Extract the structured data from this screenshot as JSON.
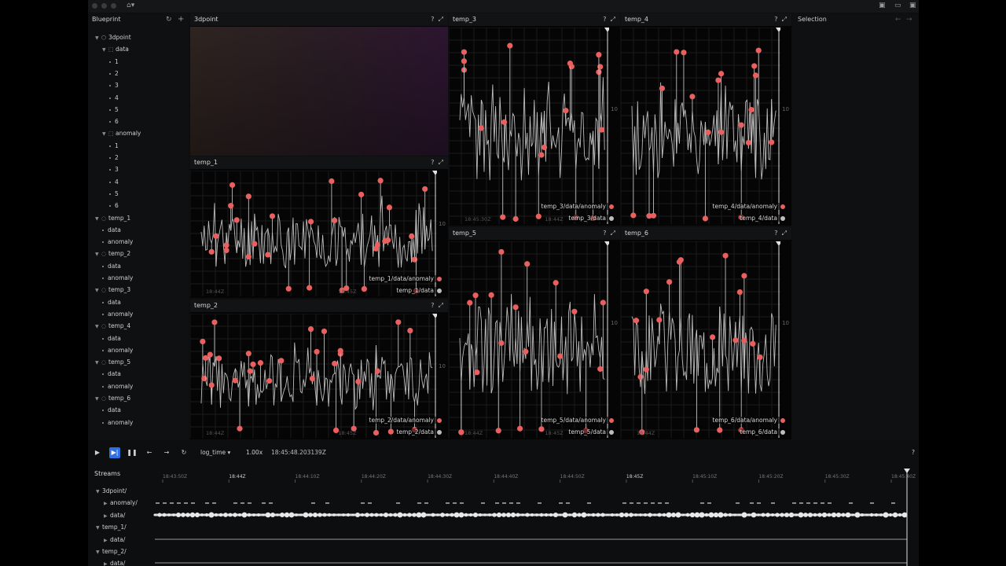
{
  "window": {
    "title_icon": "app-icon"
  },
  "blueprint": {
    "title": "Blueprint",
    "tree": [
      {
        "label": "3dpoint",
        "level": 0,
        "kind": "space"
      },
      {
        "label": "data",
        "level": 1,
        "kind": "group"
      },
      {
        "label": "1",
        "level": 2,
        "kind": "leaf"
      },
      {
        "label": "2",
        "level": 2,
        "kind": "leaf"
      },
      {
        "label": "3",
        "level": 2,
        "kind": "leaf"
      },
      {
        "label": "4",
        "level": 2,
        "kind": "leaf"
      },
      {
        "label": "5",
        "level": 2,
        "kind": "leaf"
      },
      {
        "label": "6",
        "level": 2,
        "kind": "leaf"
      },
      {
        "label": "anomaly",
        "level": 1,
        "kind": "group"
      },
      {
        "label": "1",
        "level": 2,
        "kind": "leaf"
      },
      {
        "label": "2",
        "level": 2,
        "kind": "leaf"
      },
      {
        "label": "3",
        "level": 2,
        "kind": "leaf"
      },
      {
        "label": "4",
        "level": 2,
        "kind": "leaf"
      },
      {
        "label": "5",
        "level": 2,
        "kind": "leaf"
      },
      {
        "label": "6",
        "level": 2,
        "kind": "leaf"
      },
      {
        "label": "temp_1",
        "level": 0,
        "kind": "series"
      },
      {
        "label": "data",
        "level": 1,
        "kind": "leaf"
      },
      {
        "label": "anomaly",
        "level": 1,
        "kind": "leaf"
      },
      {
        "label": "temp_2",
        "level": 0,
        "kind": "series"
      },
      {
        "label": "data",
        "level": 1,
        "kind": "leaf"
      },
      {
        "label": "anomaly",
        "level": 1,
        "kind": "leaf"
      },
      {
        "label": "temp_3",
        "level": 0,
        "kind": "series"
      },
      {
        "label": "data",
        "level": 1,
        "kind": "leaf"
      },
      {
        "label": "anomaly",
        "level": 1,
        "kind": "leaf"
      },
      {
        "label": "temp_4",
        "level": 0,
        "kind": "series"
      },
      {
        "label": "data",
        "level": 1,
        "kind": "leaf"
      },
      {
        "label": "anomaly",
        "level": 1,
        "kind": "leaf"
      },
      {
        "label": "temp_5",
        "level": 0,
        "kind": "series"
      },
      {
        "label": "data",
        "level": 1,
        "kind": "leaf"
      },
      {
        "label": "anomaly",
        "level": 1,
        "kind": "leaf"
      },
      {
        "label": "temp_6",
        "level": 0,
        "kind": "series"
      },
      {
        "label": "data",
        "level": 1,
        "kind": "leaf"
      },
      {
        "label": "anomaly",
        "level": 1,
        "kind": "leaf"
      }
    ]
  },
  "views": {
    "v3d": {
      "title": "3dpoint"
    },
    "temp_1": {
      "title": "temp_1",
      "legend_anomaly": "temp_1/data/anomaly",
      "legend_data": "temp_1/data",
      "ytick": "10",
      "time_left": "18:44Z",
      "time_right": "18:45Z",
      "seed": 11
    },
    "temp_2": {
      "title": "temp_2",
      "legend_anomaly": "temp_2/data/anomaly",
      "legend_data": "temp_2/data",
      "ytick": "10",
      "time_left": "18:44Z",
      "time_right": "18:45Z",
      "seed": 23
    },
    "temp_3": {
      "title": "temp_3",
      "legend_anomaly": "temp_3/data/anomaly",
      "legend_data": "temp_3/data",
      "ytick": "10",
      "time_left": "18:45:30Z",
      "time_right": "18:44Z",
      "seed": 37
    },
    "temp_4": {
      "title": "temp_4",
      "legend_anomaly": "temp_4/data/anomaly",
      "legend_data": "temp_4/data",
      "ytick": "10",
      "time_left": "",
      "time_right": "",
      "seed": 41
    },
    "temp_5": {
      "title": "temp_5",
      "legend_anomaly": "temp_5/data/anomaly",
      "legend_data": "temp_5/data",
      "ytick": "10",
      "time_left": "18:44Z",
      "time_right": "18:45Z",
      "seed": 53
    },
    "temp_6": {
      "title": "temp_6",
      "legend_anomaly": "temp_6/data/anomaly",
      "legend_data": "temp_6/data",
      "ytick": "10",
      "time_left": "18:44Z",
      "time_right": "",
      "seed": 67
    }
  },
  "header_icons": {
    "help": "?",
    "maximize": "⤢"
  },
  "selection": {
    "title": "Selection"
  },
  "colors": {
    "anomaly": "#e8605f",
    "data": "#bdbdbd",
    "accent": "#2f6fe0"
  },
  "timeline": {
    "timeline_name": "log_time",
    "speed": "1.00x",
    "current_time": "18:45:48.203139Z",
    "help": "?"
  },
  "streams": {
    "title": "Streams",
    "rows": [
      {
        "label": "3dpoint/",
        "level": 0
      },
      {
        "label": "anomaly/",
        "level": 1
      },
      {
        "label": "data/",
        "level": 1
      },
      {
        "label": "temp_1/",
        "level": 0
      },
      {
        "label": "data/",
        "level": 1
      },
      {
        "label": "temp_2/",
        "level": 0
      },
      {
        "label": "data/",
        "level": 1
      }
    ],
    "ticks": [
      "18:43:50Z",
      "18:44Z",
      "18:44:10Z",
      "18:44:20Z",
      "18:44:30Z",
      "18:44:40Z",
      "18:44:50Z",
      "18:45Z",
      "18:45:10Z",
      "18:45:20Z",
      "18:45:30Z",
      "18:45:40Z"
    ]
  }
}
